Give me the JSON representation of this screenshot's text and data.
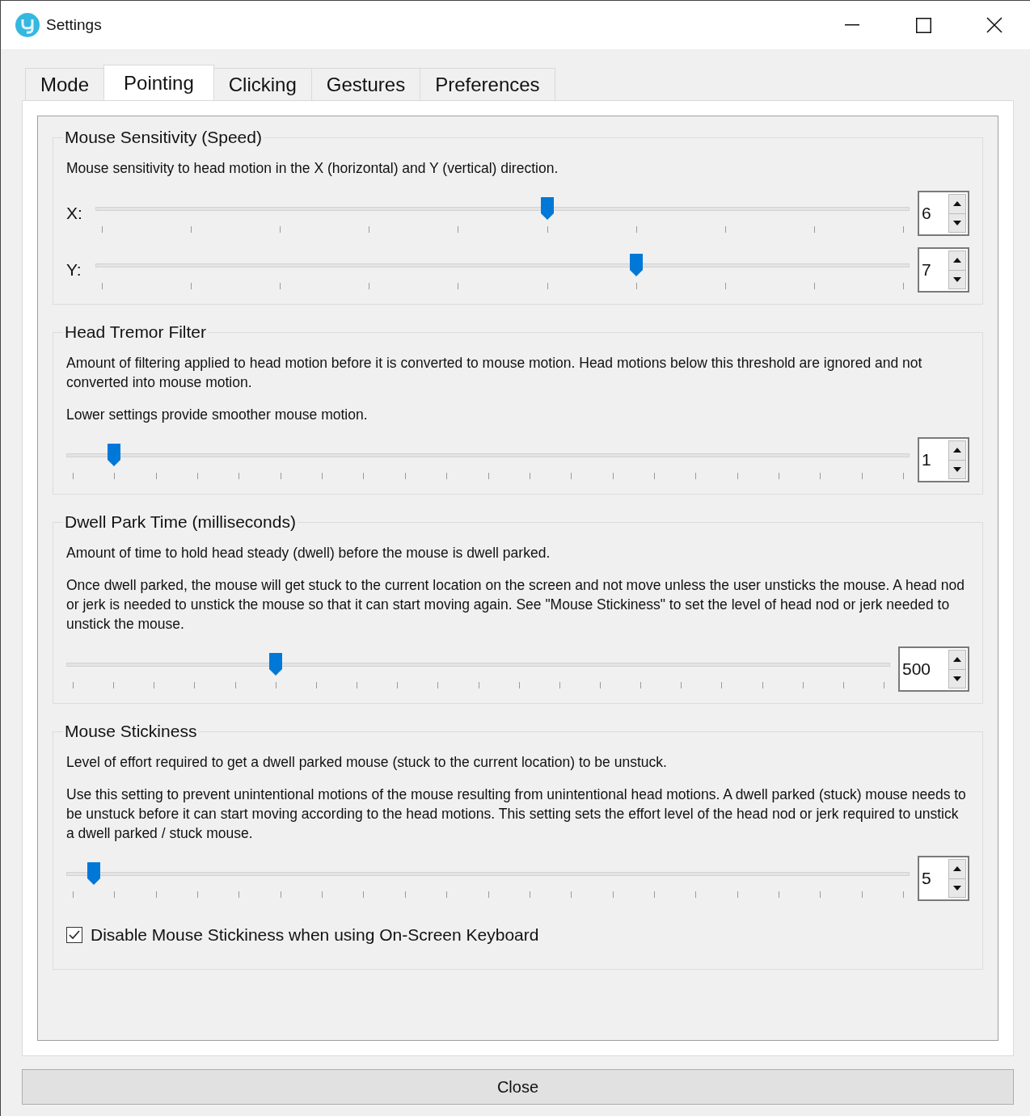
{
  "window": {
    "title": "Settings"
  },
  "tabs": [
    {
      "label": "Mode",
      "selected": false
    },
    {
      "label": "Pointing",
      "selected": true
    },
    {
      "label": "Clicking",
      "selected": false
    },
    {
      "label": "Gestures",
      "selected": false
    },
    {
      "label": "Preferences",
      "selected": false
    }
  ],
  "sections": [
    {
      "title": "Mouse Sensitivity (Speed)",
      "paragraphs": [
        "Mouse sensitivity to head motion in the X (horizontal) and Y (vertical) direction."
      ],
      "sliders": [
        {
          "label": "X:",
          "level": 0.556,
          "value": "6"
        },
        {
          "label": "Y:",
          "level": 0.667,
          "value": "7"
        }
      ]
    },
    {
      "title": "Head Tremor Filter",
      "paragraphs": [
        "Amount of filtering applied to head motion before it is converted to mouse motion. Head motions below this threshold are ignored and not converted into mouse motion.",
        "Lower settings provide smoother mouse motion."
      ],
      "sliders": [
        {
          "level": 0.05,
          "value": "1"
        }
      ]
    },
    {
      "title": "Dwell Park Time (milliseconds)",
      "paragraphs": [
        "Amount of time to hold head steady (dwell) before the mouse is dwell parked.",
        "Once dwell parked, the mouse will get stuck to the current location on the screen and not move unless the user unsticks the mouse. A head nod or jerk is needed to unstick the mouse so that it can start moving again. See \"Mouse Stickiness\" to set the level of head nod or jerk needed to unstick the mouse."
      ],
      "sliders": [
        {
          "level": 0.25,
          "value": "500"
        }
      ]
    },
    {
      "title": "Mouse Stickiness",
      "paragraphs": [
        "Level of effort required to get a dwell parked mouse (stuck to the current location) to be unstuck.",
        "Use this setting to prevent unintentional motions of the mouse resulting from unintentional head motions. A dwell parked (stuck) mouse needs to be unstuck before it can start moving according to the head motions. This setting sets the effort level of the head nod or jerk required to unstick a dwell parked / stuck mouse."
      ],
      "sliders": [
        {
          "level": 0.025,
          "value": "5"
        }
      ],
      "checkbox": {
        "label": "Disable Mouse Stickiness when using On-Screen Keyboard",
        "checked": true
      }
    }
  ],
  "close_button": "Close"
}
